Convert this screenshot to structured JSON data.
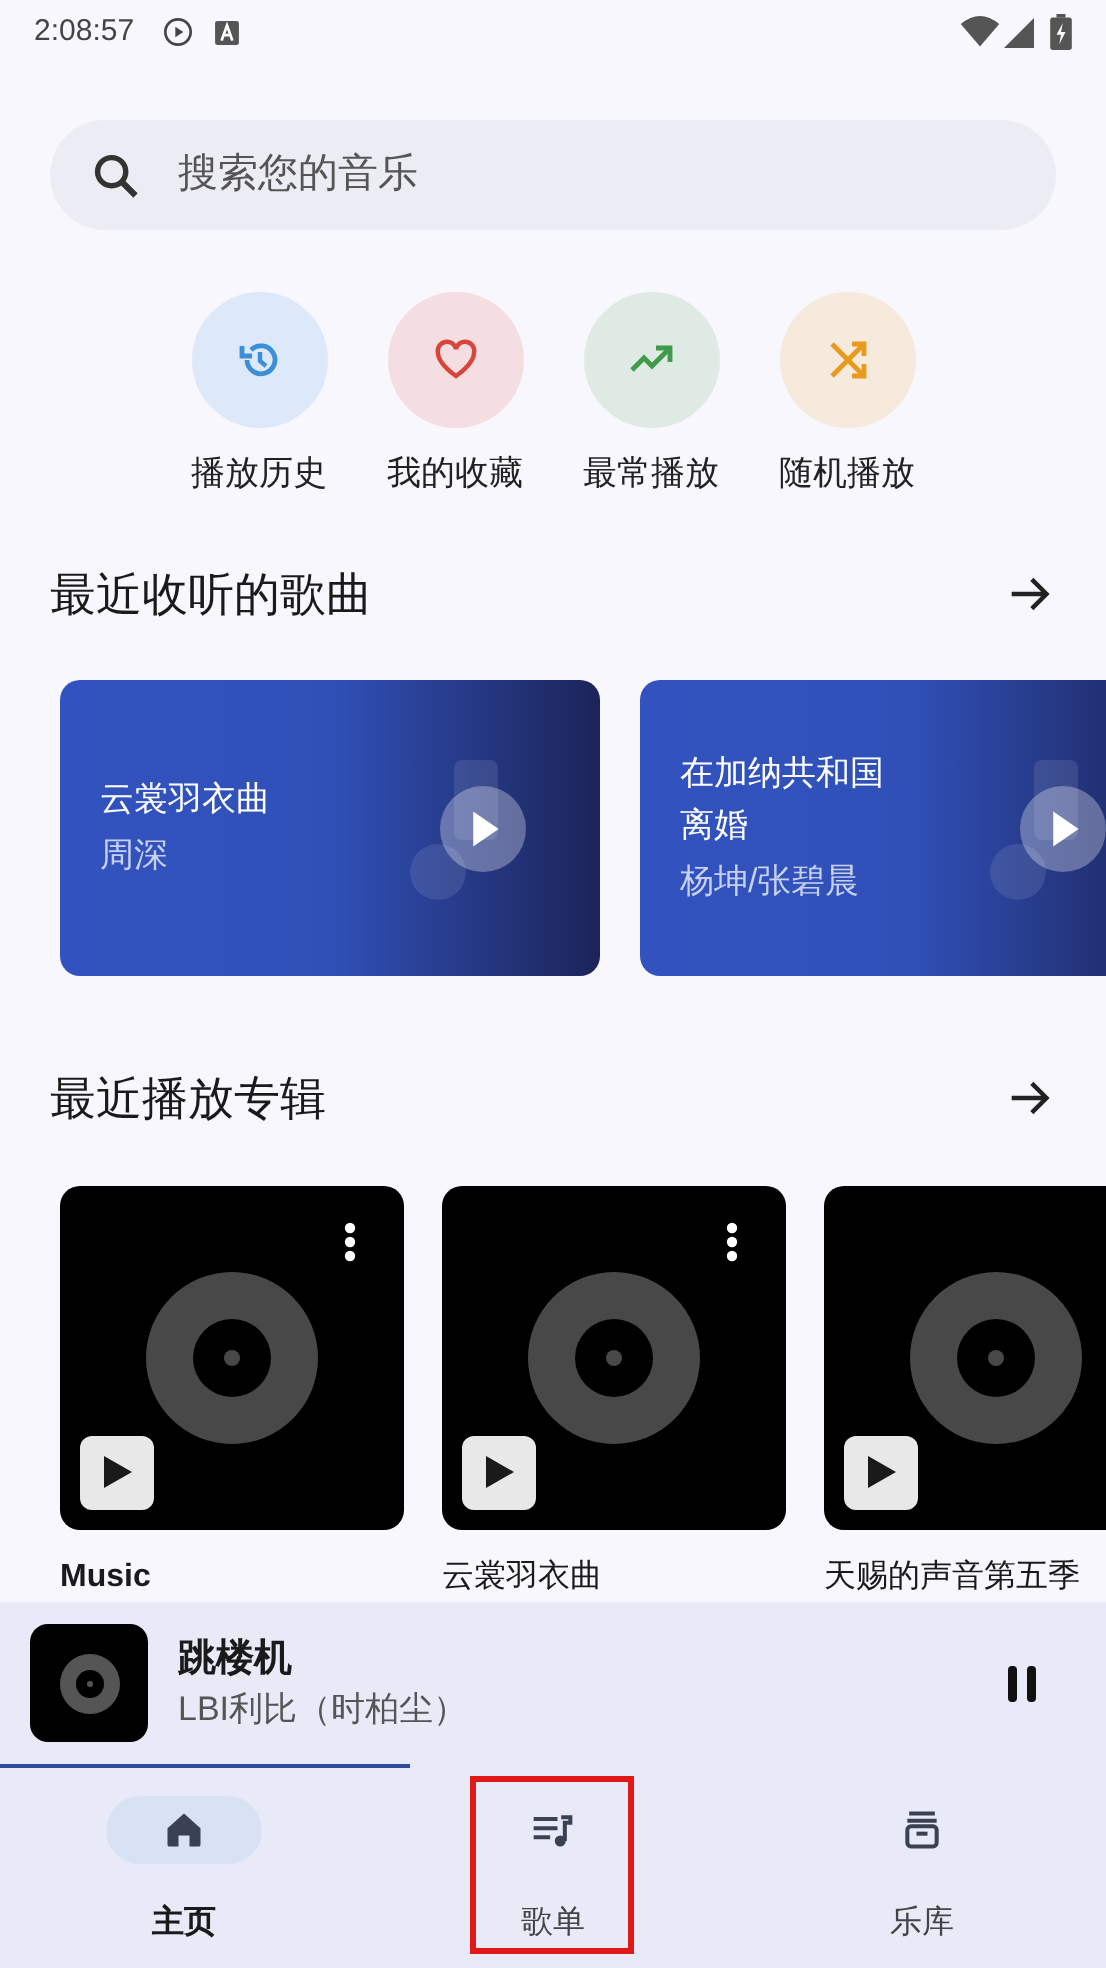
{
  "status_bar": {
    "time": "2:08:57"
  },
  "search": {
    "placeholder": "搜索您的音乐"
  },
  "quick_actions": [
    {
      "label": "播放历史",
      "kind": "history",
      "color": "#3b8fd9"
    },
    {
      "label": "我的收藏",
      "kind": "favorite",
      "color": "#d9443b"
    },
    {
      "label": "最常播放",
      "kind": "trending",
      "color": "#3f9a4a"
    },
    {
      "label": "随机播放",
      "kind": "shuffle",
      "color": "#e89a1c"
    }
  ],
  "recent_songs": {
    "title": "最近收听的歌曲",
    "items": [
      {
        "title": "云裳羽衣曲",
        "artist": "周深"
      },
      {
        "title": "在加纳共和国离婚",
        "artist": "杨坤/张碧晨"
      }
    ]
  },
  "recent_albums": {
    "title": "最近播放专辑",
    "items": [
      {
        "title": "Music",
        "bold": true
      },
      {
        "title": "云裳羽衣曲",
        "bold": false
      },
      {
        "title": "天赐的声音第五季",
        "bold": false
      }
    ]
  },
  "now_playing": {
    "title": "跳楼机",
    "artist": "LBI利比（时柏尘）",
    "playing": true,
    "level": 0.37
  },
  "nav": [
    {
      "label": "主页",
      "kind": "home",
      "selected": true,
      "highlighted": false
    },
    {
      "label": "歌单",
      "kind": "playlist",
      "selected": false,
      "highlighted": true
    },
    {
      "label": "乐库",
      "kind": "library",
      "selected": false,
      "highlighted": false
    }
  ]
}
